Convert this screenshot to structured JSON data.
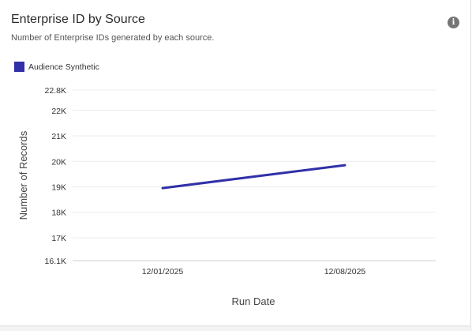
{
  "card": {
    "title": "Enterprise ID by Source",
    "subtitle": "Number of Enterprise IDs generated by each source.",
    "info_icon": "info-icon"
  },
  "chart_data": {
    "type": "line",
    "title": "Enterprise ID by Source",
    "subtitle": "Number of Enterprise IDs generated by each source.",
    "xlabel": "Run Date",
    "ylabel": "Number of Records",
    "x": [
      "12/01/2025",
      "12/08/2025"
    ],
    "series": [
      {
        "name": "Audience Synthetic",
        "color": "#3130A8",
        "values": [
          18950,
          19850
        ]
      }
    ],
    "ylim": [
      16100,
      22800
    ],
    "yticks": [
      16100,
      17000,
      18000,
      19000,
      20000,
      21000,
      22000,
      22800
    ],
    "ytick_labels": [
      "16.1K",
      "17K",
      "18K",
      "19K",
      "20K",
      "21K",
      "22K",
      "22.8K"
    ],
    "grid": true,
    "legend_position": "top-left"
  }
}
